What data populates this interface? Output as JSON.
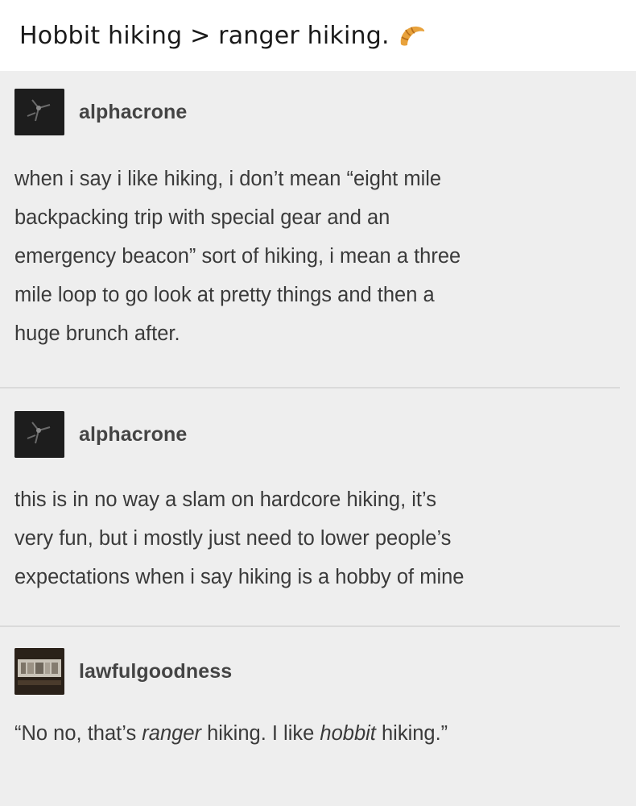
{
  "caption": {
    "text": "Hobbit hiking > ranger hiking.",
    "icon": "croissant-icon"
  },
  "posts": [
    {
      "username": "alphacrone",
      "avatar": "dark-avatar",
      "body": "when i say i like hiking, i don’t mean “eight mile\nbackpacking trip with special gear and an\nemergency beacon” sort of hiking, i mean a three\nmile loop to go look at pretty things and then a\nhuge brunch after."
    },
    {
      "username": "alphacrone",
      "avatar": "dark-avatar",
      "body": "this is in no way a slam on hardcore hiking, it’s\nvery fun, but i mostly just need to lower people’s\nexpectations when i say hiking is a hobby of mine"
    },
    {
      "username": "lawfulgoodness",
      "avatar": "bookshelf-avatar",
      "body_parts": [
        "“No no, that’s ",
        "ranger",
        " hiking. I like ",
        "hobbit",
        " hiking.”"
      ]
    }
  ],
  "colors": {
    "background": "#eeeeee",
    "text": "#3a3a3a",
    "username": "#444444",
    "divider": "#dadada"
  }
}
